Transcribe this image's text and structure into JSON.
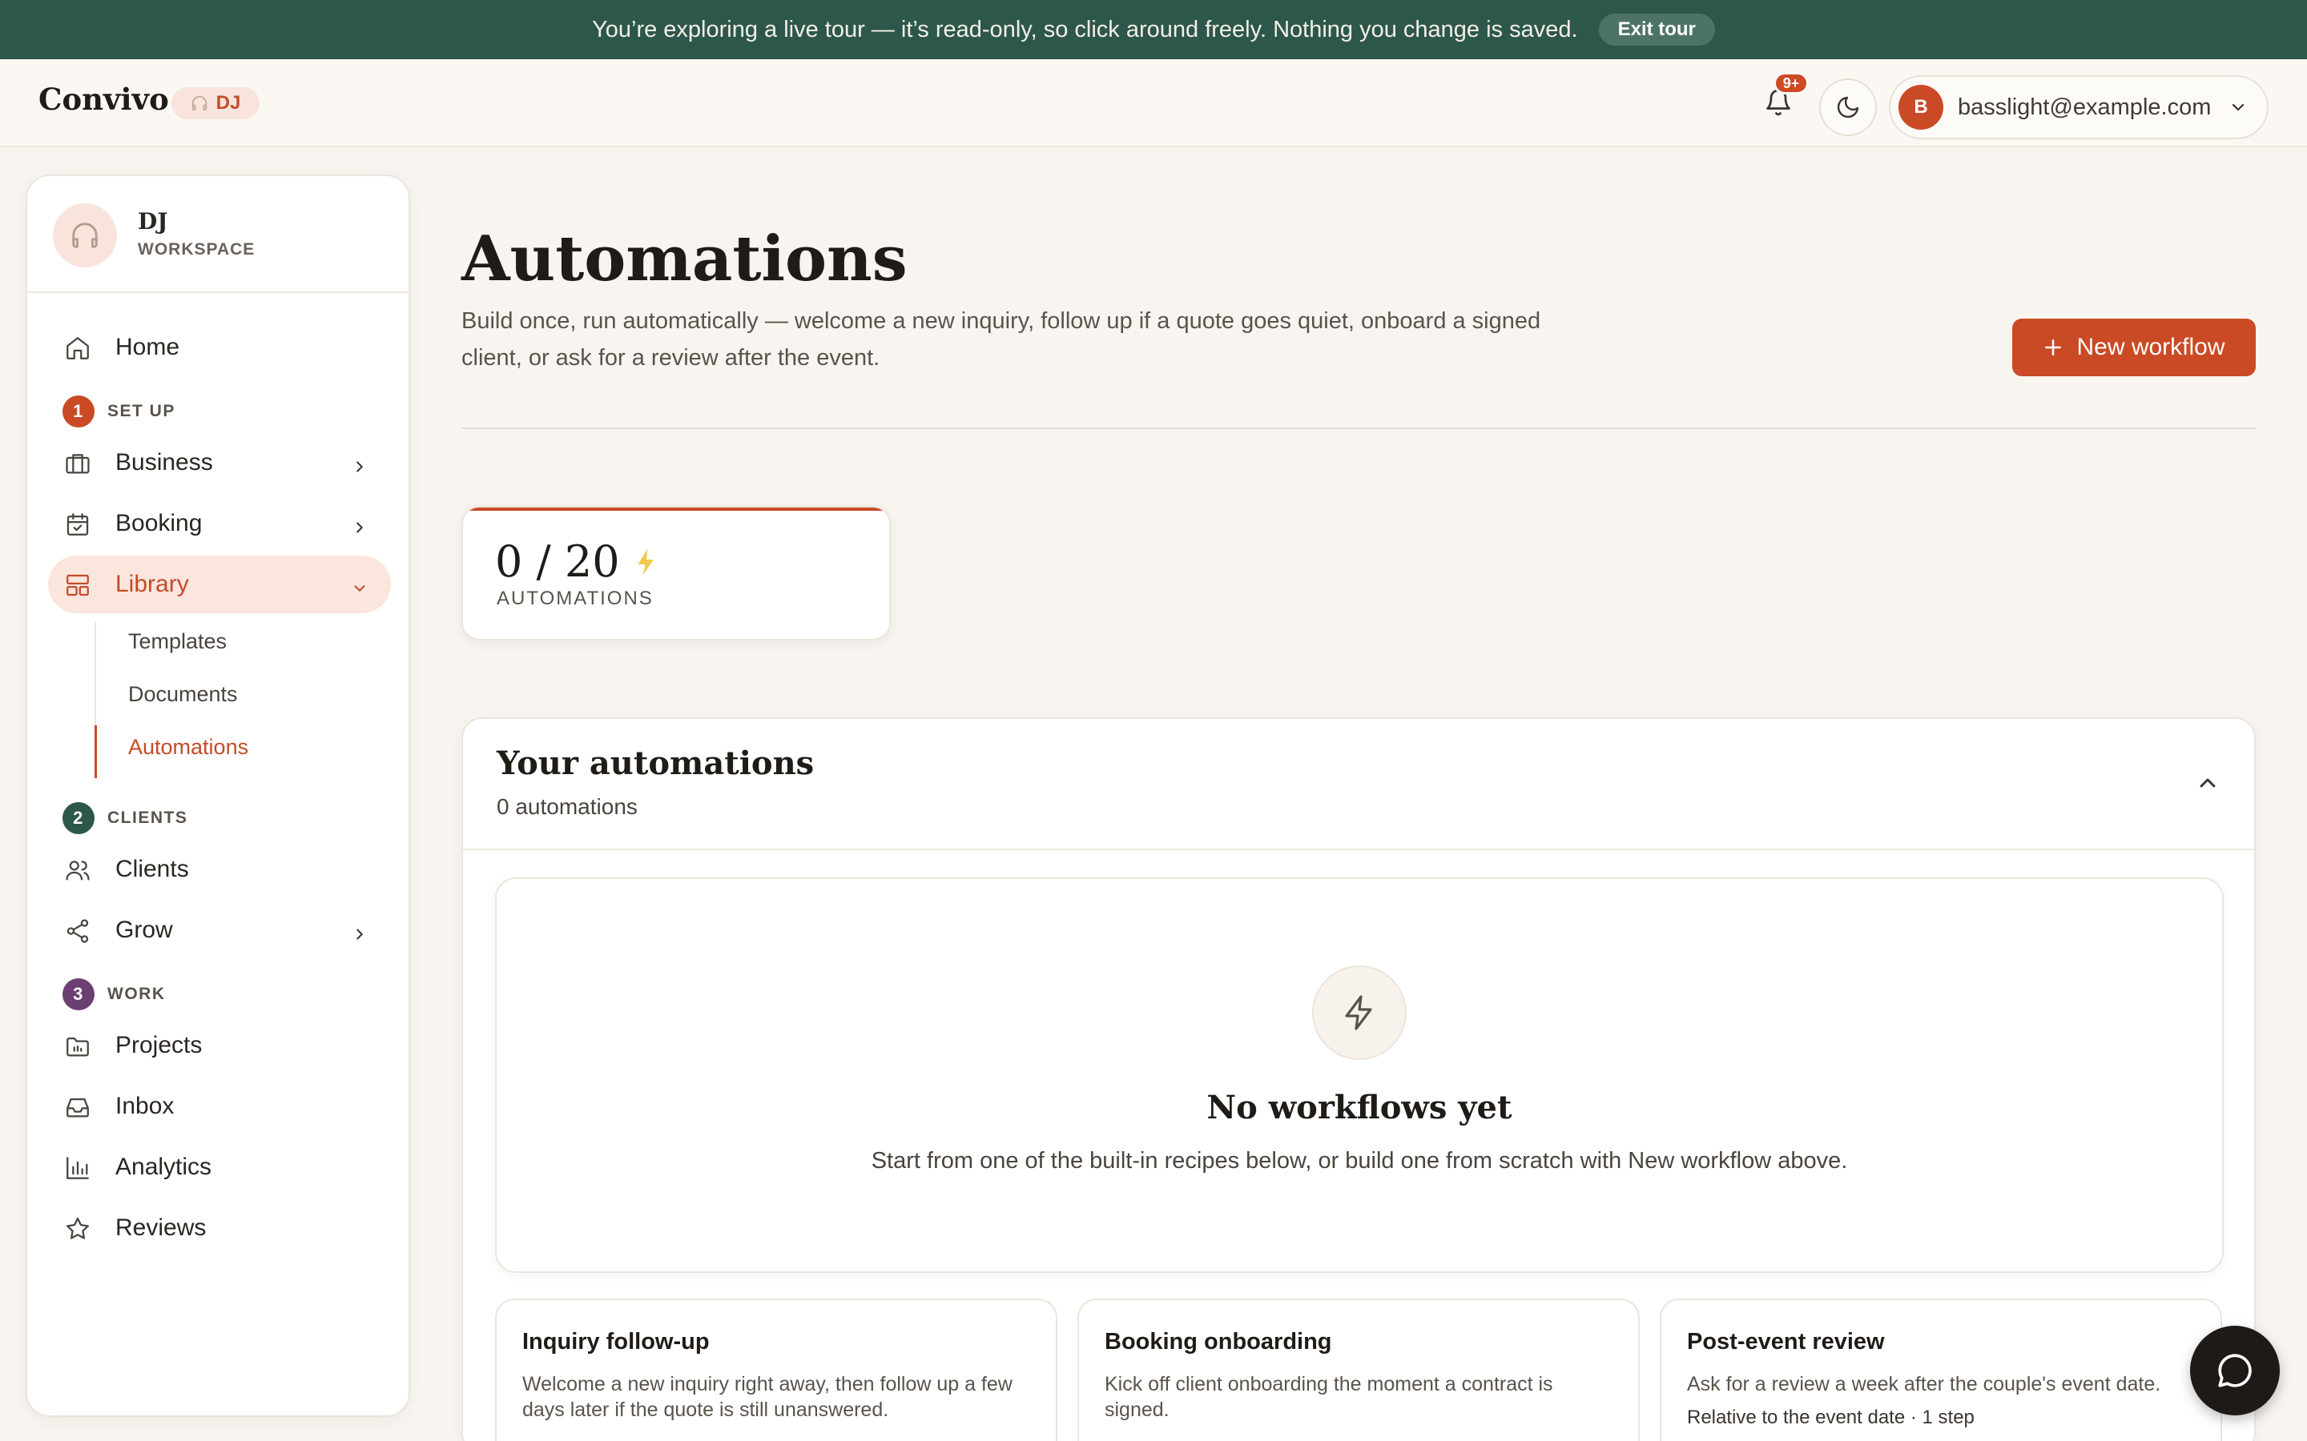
{
  "banner": {
    "text": "You’re exploring a live tour — it’s read-only, so click around freely. Nothing you change is saved.",
    "exit_label": "Exit tour"
  },
  "topbar": {
    "brand": "Convivo",
    "workspace_chip": "DJ",
    "notification_badge": "9+",
    "account_initial": "B",
    "account_email": "basslight@example.com"
  },
  "sidebar": {
    "workspace_name": "DJ",
    "workspace_sub": "WORKSPACE",
    "home": "Home",
    "sections": [
      {
        "number": "1",
        "label": "SET UP",
        "color": "#c94a24"
      },
      {
        "number": "2",
        "label": "CLIENTS",
        "color": "#2d574b"
      },
      {
        "number": "3",
        "label": "WORK",
        "color": "#6b3f72"
      }
    ],
    "items": {
      "business": "Business",
      "booking": "Booking",
      "library": "Library",
      "clients": "Clients",
      "grow": "Grow",
      "projects": "Projects",
      "inbox": "Inbox",
      "analytics": "Analytics",
      "reviews": "Reviews"
    },
    "library_sub": [
      "Templates",
      "Documents",
      "Automations"
    ]
  },
  "main": {
    "title": "Automations",
    "description": "Build once, run automatically — welcome a new inquiry, follow up if a quote goes quiet, onboard a signed client, or ask for a review after the event.",
    "new_button": "New workflow",
    "stat": {
      "value": "0 / 20",
      "label": "AUTOMATIONS"
    },
    "panel": {
      "title": "Your automations",
      "count": "0 automations",
      "empty_title": "No workflows yet",
      "empty_desc": "Start from one of the built-in recipes below, or build one from scratch with New workflow above."
    },
    "recipes": [
      {
        "title": "Inquiry follow-up",
        "desc": "Welcome a new inquiry right away, then follow up a few days later if the quote is still unanswered.",
        "meta": ""
      },
      {
        "title": "Booking onboarding",
        "desc": "Kick off client onboarding the moment a contract is signed.",
        "meta": ""
      },
      {
        "title": "Post-event review",
        "desc": "Ask for a review a week after the couple's event date.",
        "meta": "Relative to the event date · 1 step"
      }
    ]
  },
  "colors": {
    "accent": "#c94a24",
    "banner": "#2d574b",
    "background": "#f8f5f1"
  }
}
